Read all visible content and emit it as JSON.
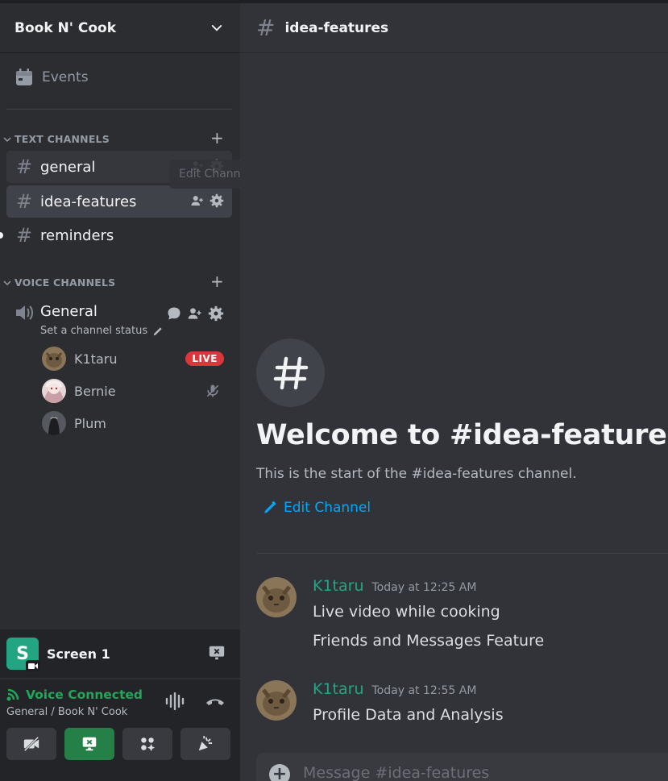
{
  "server": {
    "name": "Book N' Cook"
  },
  "events_label": "Events",
  "categories": {
    "text": "TEXT CHANNELS",
    "voice": "VOICE CHANNELS"
  },
  "text_channels": [
    {
      "name": "general"
    },
    {
      "name": "idea-features"
    },
    {
      "name": "reminders"
    }
  ],
  "tooltip": "Edit Channel",
  "voice_channel": {
    "name": "General",
    "status": "Set a channel status",
    "users": [
      {
        "name": "K1taru",
        "badge": "LIVE"
      },
      {
        "name": "Bernie"
      },
      {
        "name": "Plum"
      }
    ]
  },
  "screen_share": {
    "label": "Screen 1",
    "initial": "S"
  },
  "voice_panel": {
    "title": "Voice Connected",
    "subtitle": "General / Book N' Cook"
  },
  "main": {
    "channel": "idea-features",
    "welcome_title": "Welcome to #idea-features!",
    "welcome_sub": "This is the start of the #idea-features channel.",
    "edit_link": "Edit Channel",
    "composer_placeholder": "Message #idea-features"
  },
  "messages": [
    {
      "author": "K1taru",
      "time": "Today at 12:25 AM",
      "lines": [
        "Live video while cooking",
        "Friends and Messages Feature"
      ]
    },
    {
      "author": "K1taru",
      "time": "Today at 12:55 AM",
      "lines": [
        "Profile Data and Analysis"
      ]
    }
  ],
  "colors": {
    "accent_green": "#23a55a",
    "author_color": "#23a583",
    "live_red": "#da373c",
    "link_blue": "#00a8fc"
  }
}
